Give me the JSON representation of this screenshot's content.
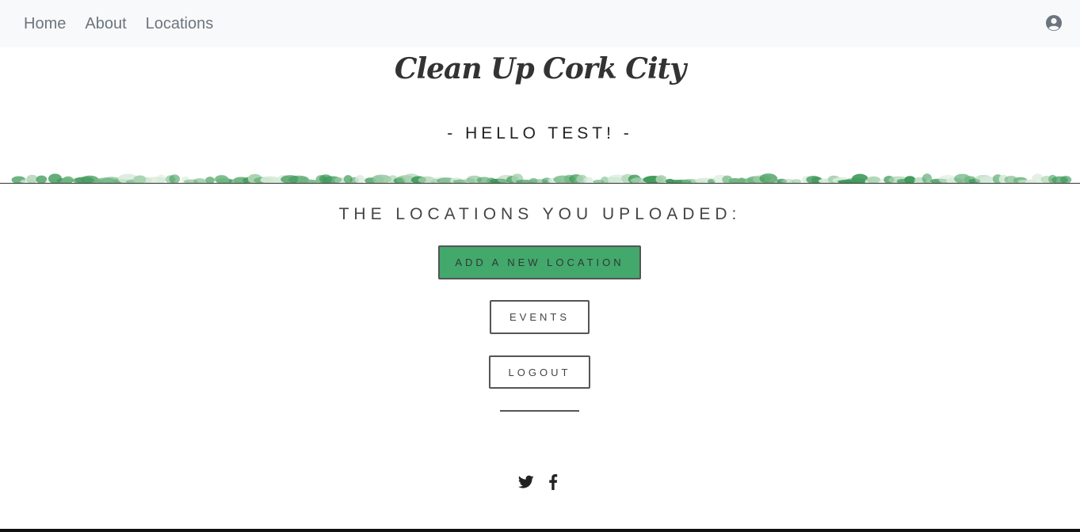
{
  "nav": {
    "links": [
      "Home",
      "About",
      "Locations"
    ],
    "user_icon": "user-circle-icon"
  },
  "header": {
    "title": "Clean Up Cork City",
    "greeting": "- HELLO TEST! -"
  },
  "decoration": {
    "leaf_strip": "leaf-garland",
    "leaf_colors": [
      "#3f9a5a",
      "#6fb57f",
      "#a9d3b0",
      "#d6ebd9"
    ]
  },
  "main": {
    "heading": "THE LOCATIONS YOU UPLOADED:",
    "add_button": "ADD A NEW LOCATION",
    "events_button": "EVENTS",
    "logout_button": "LOGOUT"
  },
  "footer": {
    "icons": [
      "twitter-icon",
      "facebook-icon"
    ]
  },
  "colors": {
    "navbar_bg": "#f8f9fa",
    "nav_text": "#6c757d",
    "accent_green": "#43a86c",
    "text_dark": "#333333"
  }
}
